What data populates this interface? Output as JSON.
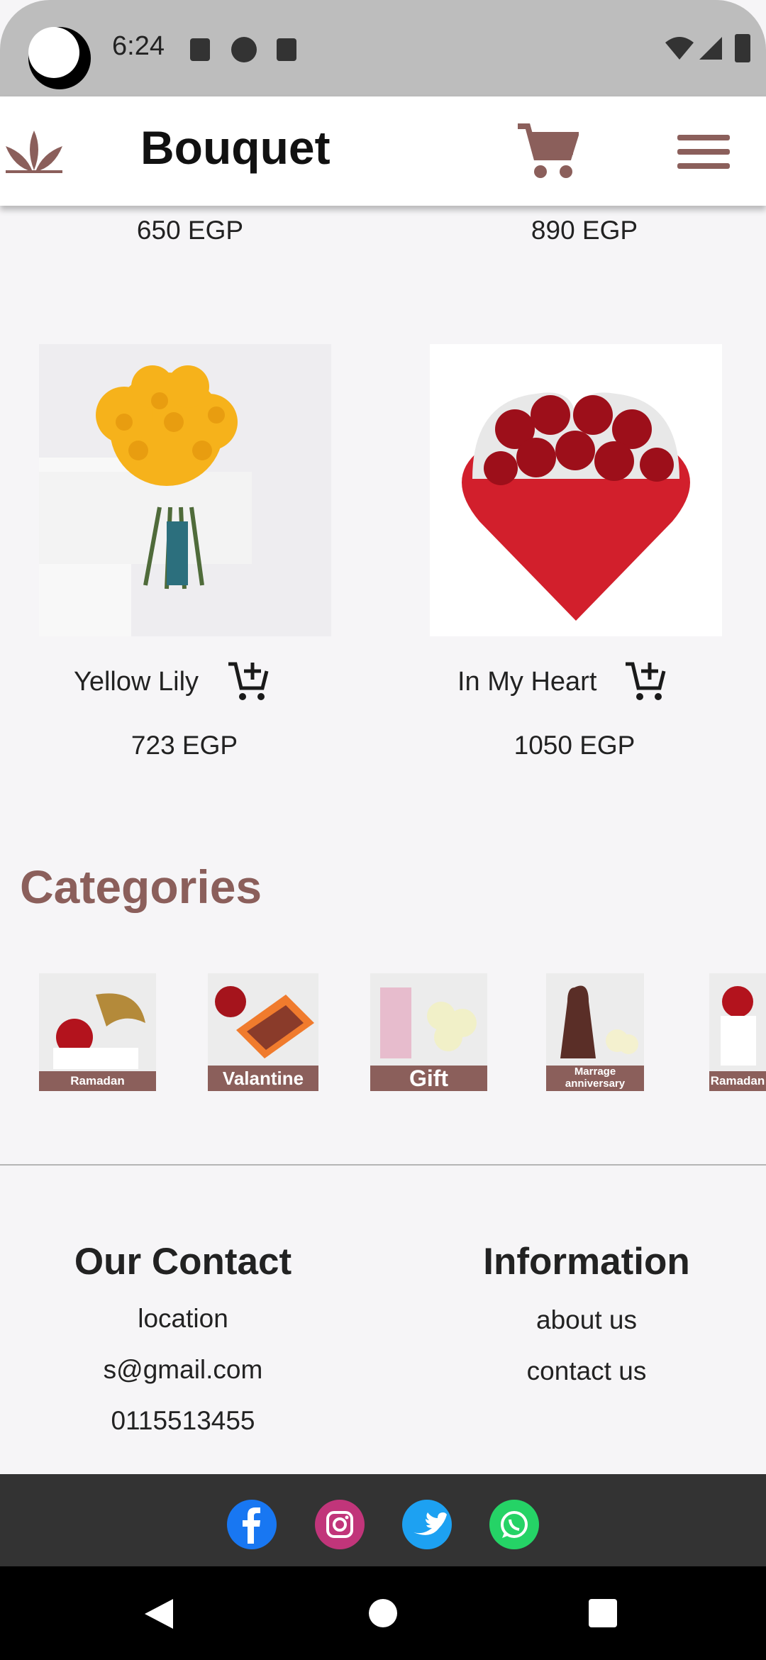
{
  "status": {
    "time": "6:24"
  },
  "appbar": {
    "title": "Bouquet"
  },
  "products": {
    "prev_prices": [
      "650 EGP",
      "890 EGP"
    ],
    "items": [
      {
        "name": "Yellow Lily",
        "price": "723 EGP"
      },
      {
        "name": "In My Heart",
        "price": "1050 EGP"
      }
    ]
  },
  "categories": {
    "title": "Categories",
    "items": [
      {
        "label": "Ramadan"
      },
      {
        "label": "Valantine"
      },
      {
        "label": "Gift"
      },
      {
        "label": "Marrage anniversary"
      },
      {
        "label": "Ramadan"
      }
    ]
  },
  "footer": {
    "contact": {
      "title": "Our Contact",
      "location": "location",
      "email": "s@gmail.com",
      "phone": "0115513455"
    },
    "info": {
      "title": "Information",
      "about": "about us",
      "contact": "contact us"
    }
  },
  "social": [
    "facebook-icon",
    "instagram-icon",
    "twitter-icon",
    "whatsapp-icon"
  ],
  "colors": {
    "brand": "#8b5f5b",
    "status_bar": "#bdbdbd",
    "social_bar": "#333333"
  }
}
